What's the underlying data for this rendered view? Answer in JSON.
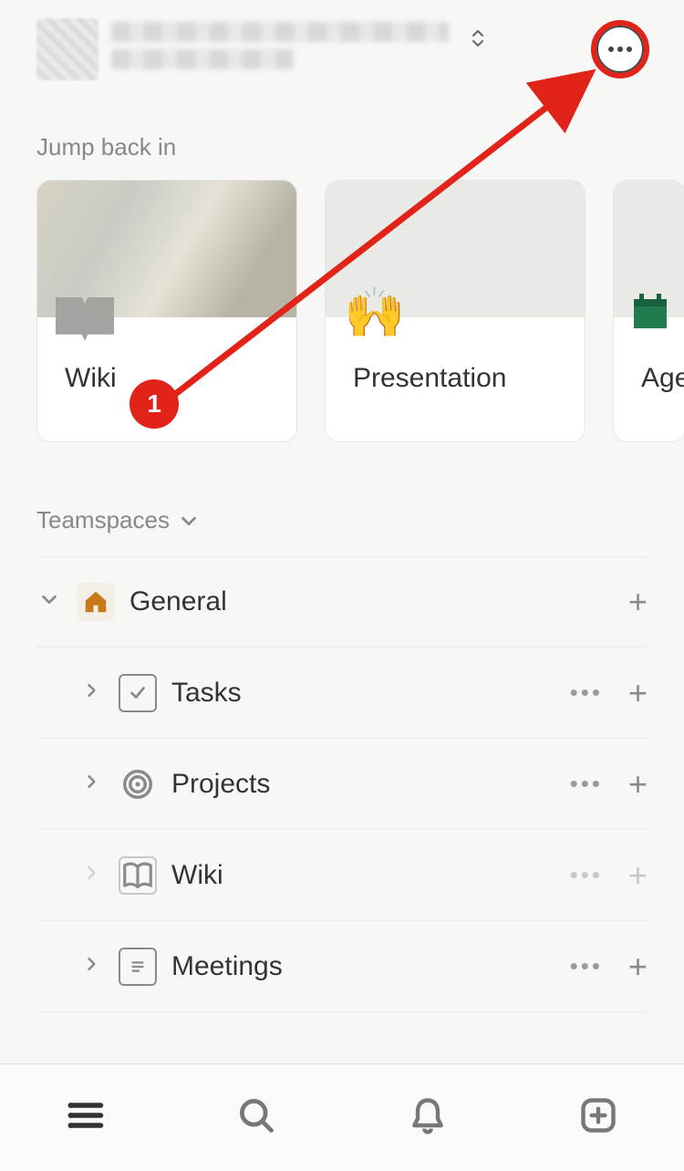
{
  "header": {
    "workspace_name_line1": "████████ ████ ████",
    "workspace_name_line2": "██████ ██"
  },
  "jump": {
    "title": "Jump back in",
    "cards": [
      {
        "title": "Wiki",
        "icon": "book"
      },
      {
        "title": "Presentation",
        "icon": "🙌"
      },
      {
        "title": "Age",
        "icon": "calendar"
      }
    ]
  },
  "teamspaces": {
    "title": "Teamspaces",
    "root": {
      "label": "General",
      "icon": "home"
    },
    "pages": [
      {
        "label": "Tasks",
        "icon": "check"
      },
      {
        "label": "Projects",
        "icon": "target"
      },
      {
        "label": "Wiki",
        "icon": "openbook",
        "dim": true
      },
      {
        "label": "Meetings",
        "icon": "doc"
      }
    ]
  },
  "annotation": {
    "badge": "1"
  },
  "colors": {
    "accent": "#e1231a"
  }
}
